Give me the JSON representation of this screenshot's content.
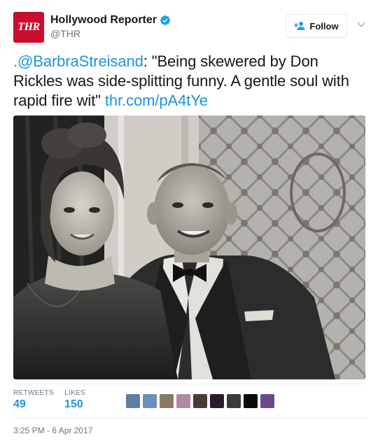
{
  "account": {
    "avatar_text": "THR",
    "display_name": "Hollywood Reporter",
    "handle": "@THR",
    "verified": true,
    "brand_color": "#c8102e"
  },
  "follow_button": {
    "label": "Follow",
    "icon": "follow-user-icon"
  },
  "menu": {
    "icon": "chevron-down-icon"
  },
  "tweet": {
    "mention": ".@BarbraStreisand",
    "body": ": \"Being skewered by Don Rickles was side-splitting funny. A gentle soul with rapid fire wit\" ",
    "link": "thr.com/pA4tYe",
    "link_color": "#1b95e0"
  },
  "stats": {
    "retweets_label": "RETWEETS",
    "retweets_value": "49",
    "likes_label": "LIKES",
    "likes_value": "150"
  },
  "likers": [
    "#5b7fa6",
    "#6a8fb8",
    "#8a7a60",
    "#b08aa0",
    "#4a3a30",
    "#2a1a2a",
    "#3a3a3a",
    "#0a0a0a",
    "#6a4a8a"
  ],
  "timestamp": "3:25 PM - 6 Apr 2017"
}
